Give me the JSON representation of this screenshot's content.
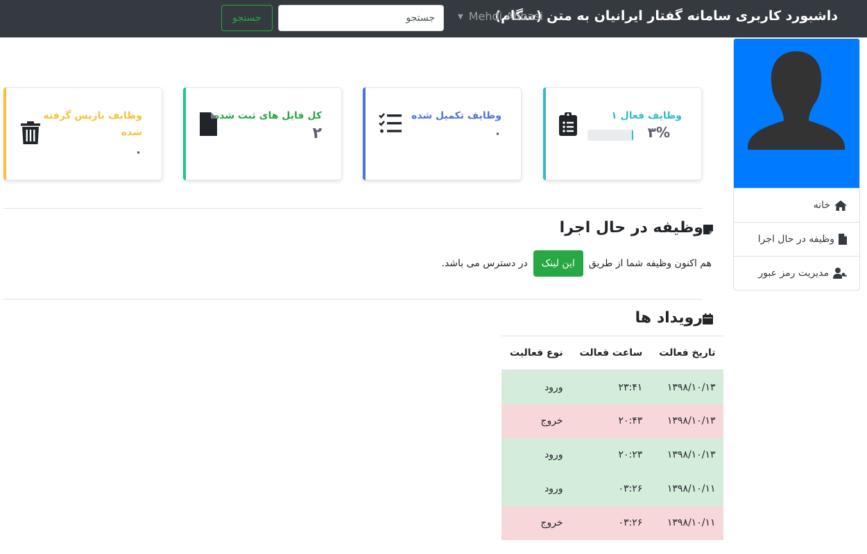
{
  "navbar": {
    "brand": "داشبورد کاربری سامانه گفتار ایرانیان به متن (سگام)",
    "user": "Mehdi Abbasi",
    "search_placeholder": "جستجو",
    "search_button": "جستجو"
  },
  "sidebar": {
    "items": [
      {
        "label": "خانه",
        "icon": "home-icon"
      },
      {
        "label": "وظیفه در حال اجرا",
        "icon": "file-icon"
      },
      {
        "label": "مدیریت رمز عبور",
        "icon": "user-key-icon"
      }
    ]
  },
  "cards": {
    "active": {
      "title": "وظایف فعال ۱",
      "value": "۳%",
      "progress": 0.03,
      "color": "#36b9cc",
      "icon": "clipboard-list-icon"
    },
    "done": {
      "title": "وظایف تکمیل شده",
      "value": "۰",
      "color": "#4e73df",
      "icon": "tasks-icon"
    },
    "files": {
      "title": "کل فایل های ثبت شده",
      "value": "۲",
      "color": "#1cc88a",
      "icon": "file-icon"
    },
    "returned": {
      "title": "وظایف بازپس گرفته شده",
      "value": "۰",
      "color": "#f6c23e",
      "icon": "trash-icon"
    }
  },
  "running": {
    "heading": "وظیفه در حال اجرا",
    "text_before": "هم اکنون وظیفه شما از طریق",
    "link_label": "این لینک",
    "text_after": "در دسترس می باشد."
  },
  "events": {
    "heading": "رویداد ها",
    "columns": [
      "تاریخ فعالت",
      "ساعت فعالت",
      "نوع فعالیت"
    ],
    "rows": [
      {
        "date": "۱۳۹۸/۱۰/۱۳",
        "time": "۲۳:۴۱",
        "type": "ورود",
        "status": "in"
      },
      {
        "date": "۱۳۹۸/۱۰/۱۳",
        "time": "۲۰:۴۳",
        "type": "خروج",
        "status": "out"
      },
      {
        "date": "۱۳۹۸/۱۰/۱۳",
        "time": "۲۰:۲۳",
        "type": "ورود",
        "status": "in"
      },
      {
        "date": "۱۳۹۸/۱۰/۱۱",
        "time": "۰۳:۲۶",
        "type": "ورود",
        "status": "in"
      },
      {
        "date": "۱۳۹۸/۱۰/۱۱",
        "time": "۰۳:۲۶",
        "type": "خروج",
        "status": "out"
      }
    ]
  }
}
